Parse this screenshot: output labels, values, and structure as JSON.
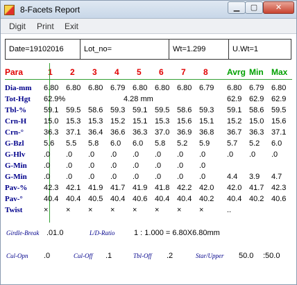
{
  "window": {
    "title": "8-Facets Report"
  },
  "menu": {
    "items": [
      "Digit",
      "Print",
      "Exit"
    ]
  },
  "info": {
    "date": "Date=19102016",
    "lot": "Lot_no=",
    "wt": "Wt=1.299",
    "uwt": "U.Wt=1"
  },
  "header": {
    "para": "Para",
    "facets": [
      "1",
      "2",
      "3",
      "4",
      "5",
      "6",
      "7",
      "8"
    ],
    "stats": [
      "Avrg",
      "Min",
      "Max"
    ]
  },
  "rows": [
    {
      "label": "Dia-mm",
      "facets": [
        "6.80",
        "6.80",
        "6.80",
        "6.79",
        "6.80",
        "6.80",
        "6.80",
        "6.79"
      ],
      "stats": [
        "6.80",
        "6.79",
        "6.80"
      ]
    },
    {
      "label": "Tot-Hgt",
      "first": "62.9%",
      "center": "4.28 mm",
      "stats": [
        "62.9",
        "62.9",
        "62.9"
      ]
    },
    {
      "label": "Tbl-%",
      "facets": [
        "59.1",
        "59.5",
        "58.6",
        "59.3",
        "59.1",
        "59.5",
        "58.6",
        "59.3"
      ],
      "stats": [
        "59.1",
        "58.6",
        "59.5"
      ]
    },
    {
      "label": "Crn-H",
      "facets": [
        "15.0",
        "15.3",
        "15.3",
        "15.2",
        "15.1",
        "15.3",
        "15.6",
        "15.1"
      ],
      "stats": [
        "15.2",
        "15.0",
        "15.6"
      ]
    },
    {
      "label": "Crn-°",
      "facets": [
        "36.3",
        "37.1",
        "36.4",
        "36.6",
        "36.3",
        "37.0",
        "36.9",
        "36.8"
      ],
      "stats": [
        "36.7",
        "36.3",
        "37.1"
      ]
    },
    {
      "label": "G-Bzl",
      "facets": [
        "5.6",
        "5.5",
        "5.8",
        "6.0",
        "6.0",
        "5.8",
        "5.2",
        "5.9"
      ],
      "stats": [
        "5.7",
        "5.2",
        "6.0"
      ]
    },
    {
      "label": "G-Hlv",
      "facets": [
        ".0",
        ".0",
        ".0",
        ".0",
        ".0",
        ".0",
        ".0",
        ".0"
      ],
      "stats": [
        ".0",
        ".0",
        ".0"
      ]
    },
    {
      "label": "G-Min",
      "facets": [
        ".0",
        ".0",
        ".0",
        ".0",
        ".0",
        ".0",
        ".0",
        ".0"
      ],
      "stats": [
        "",
        "",
        ""
      ]
    },
    {
      "label": "G-Min",
      "facets": [
        ".0",
        ".0",
        ".0",
        ".0",
        ".0",
        ".0",
        ".0",
        ".0"
      ],
      "stats": [
        "4.4",
        "3.9",
        "4.7"
      ]
    },
    {
      "label": "Pav-%",
      "facets": [
        "42.3",
        "42.1",
        "41.9",
        "41.7",
        "41.9",
        "41.8",
        "42.2",
        "42.0"
      ],
      "stats": [
        "42.0",
        "41.7",
        "42.3"
      ]
    },
    {
      "label": "Pav-°",
      "facets": [
        "40.4",
        "40.4",
        "40.5",
        "40.4",
        "40.6",
        "40.4",
        "40.4",
        "40.2"
      ],
      "stats": [
        "40.4",
        "40.2",
        "40.6"
      ]
    },
    {
      "label": "Twist",
      "facets": [
        "×",
        "×",
        "×",
        "×",
        "×",
        "×",
        "×",
        "×"
      ],
      "stats": [
        "..",
        "",
        ""
      ]
    }
  ],
  "footer": {
    "girdle_break_label": "Girdle-Break",
    "girdle_break_value": ".01.0",
    "ld_ratio_label": "L/D-Ratio",
    "ld_ratio_value": "1 : 1.000 = 6.80X6.80mm",
    "cul_open_label": "Cul-Opn",
    "cul_open_value": ".0",
    "cul_off_label": "Cul-Off",
    "cul_off_value": ".1",
    "tbl_off_label": "Tbl-Off",
    "tbl_off_value": ".2",
    "star_upper_label": "Star/Upper",
    "star_upper_value": "50.0",
    "star_upper_value2": ":50.0"
  }
}
